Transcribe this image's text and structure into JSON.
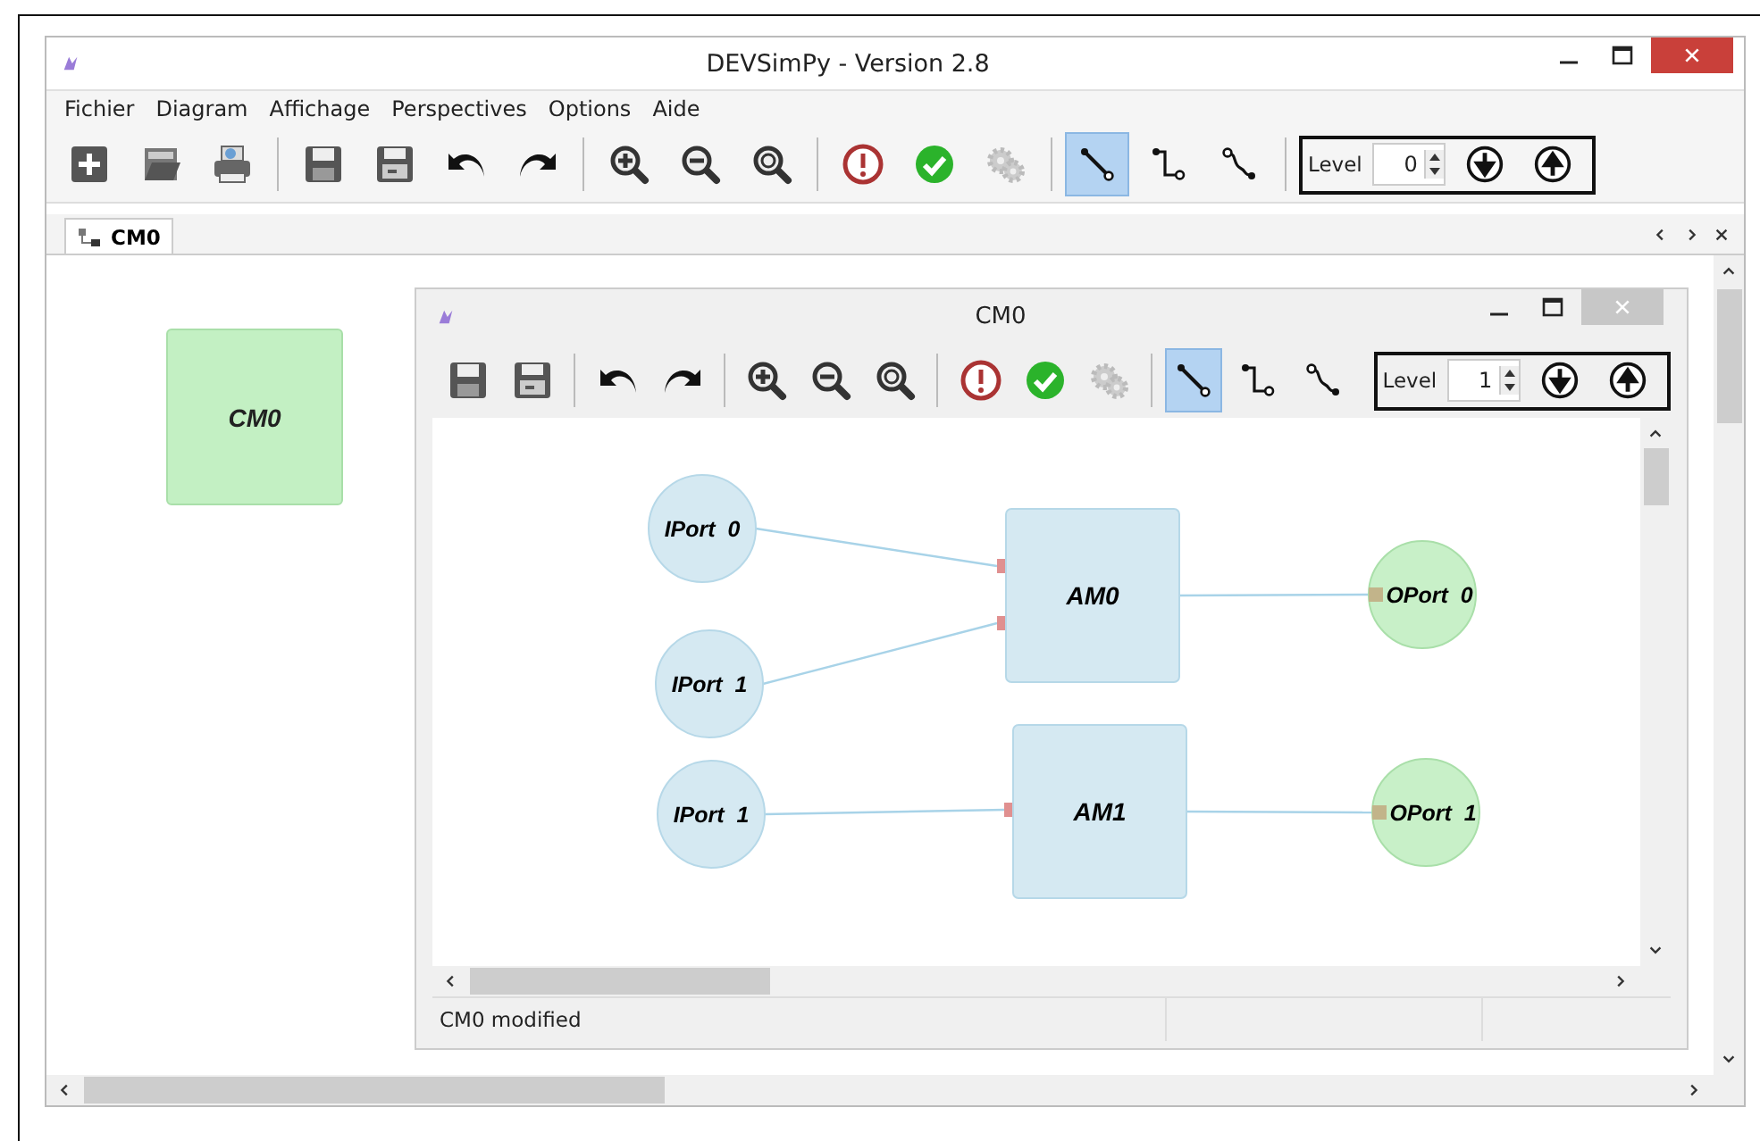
{
  "window": {
    "title": "DEVSimPy - Version 2.8"
  },
  "menu": [
    "Fichier",
    "Diagram",
    "Affichage",
    "Perspectives",
    "Options",
    "Aide"
  ],
  "toolbar": {
    "tools": [
      {
        "kind": "new"
      },
      {
        "kind": "open"
      },
      {
        "kind": "print"
      },
      {
        "kind": "separator"
      },
      {
        "kind": "save"
      },
      {
        "kind": "save-as"
      },
      {
        "kind": "undo"
      },
      {
        "kind": "redo"
      },
      {
        "kind": "separator"
      },
      {
        "kind": "zoom-in"
      },
      {
        "kind": "zoom-out"
      },
      {
        "kind": "zoom-fit"
      },
      {
        "kind": "separator"
      },
      {
        "kind": "stop"
      },
      {
        "kind": "check"
      },
      {
        "kind": "gears"
      },
      {
        "kind": "separator"
      },
      {
        "kind": "line-direct",
        "selected": true
      },
      {
        "kind": "line-square",
        "selected": false
      },
      {
        "kind": "line-curve",
        "selected": false
      },
      {
        "kind": "separator"
      }
    ],
    "level": {
      "label": "Level",
      "value": "0"
    }
  },
  "tabs": [
    {
      "label": "CM0",
      "selected": true
    }
  ],
  "canvas": {
    "blocks": [
      {
        "label": "CM0"
      }
    ]
  },
  "subwindow": {
    "title": "CM0",
    "toolbar": {
      "tools": [
        {
          "kind": "save"
        },
        {
          "kind": "save-as"
        },
        {
          "kind": "separator"
        },
        {
          "kind": "undo"
        },
        {
          "kind": "redo"
        },
        {
          "kind": "separator"
        },
        {
          "kind": "zoom-in"
        },
        {
          "kind": "zoom-out"
        },
        {
          "kind": "zoom-fit"
        },
        {
          "kind": "separator"
        },
        {
          "kind": "stop"
        },
        {
          "kind": "check"
        },
        {
          "kind": "gears"
        },
        {
          "kind": "separator"
        },
        {
          "kind": "line-direct",
          "selected": true
        },
        {
          "kind": "line-square",
          "selected": false
        },
        {
          "kind": "line-curve",
          "selected": false
        }
      ],
      "level": {
        "label": "Level",
        "value": "1"
      }
    },
    "diagram": {
      "nodes": [
        {
          "kind": "iport",
          "label": "IPort  0"
        },
        {
          "kind": "iport",
          "label": "IPort  1"
        },
        {
          "kind": "iport",
          "label": "IPort  1"
        },
        {
          "kind": "block",
          "label": "AM0"
        },
        {
          "kind": "block",
          "label": "AM1"
        },
        {
          "kind": "oport",
          "label": "OPort  0"
        },
        {
          "kind": "oport",
          "label": "OPort  1"
        }
      ]
    },
    "status_bar": [
      "CM0 modified"
    ]
  }
}
